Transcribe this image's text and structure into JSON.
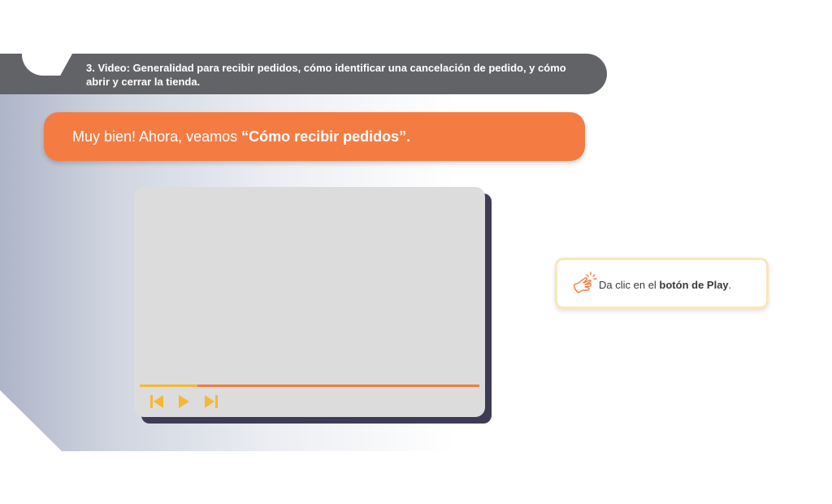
{
  "header": {
    "title": "3. Video: Generalidad para recibir pedidos, cómo identificar una cancelación de pedido, y cómo abrir y cerrar la tienda."
  },
  "banner": {
    "intro": "Muy bien! Ahora, veamos ",
    "highlight": "“Cómo recibir pedidos”."
  },
  "video": {
    "progress_percent": 17,
    "controls": [
      "skip-back",
      "play",
      "skip-forward"
    ]
  },
  "hint": {
    "prefix": "Da clic en el ",
    "bold": "botón de Play",
    "suffix": "."
  },
  "colors": {
    "accent_orange": "#f47c43",
    "progress_yellow": "#f5b833",
    "header_gray": "#626367",
    "video_shadow": "#3d3b55"
  }
}
